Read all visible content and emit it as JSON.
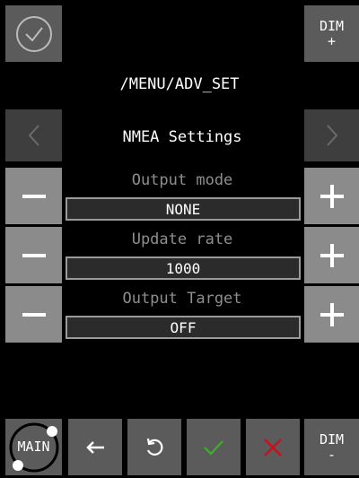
{
  "header": {
    "path": "/MENU/ADV_SET",
    "dim_plus": {
      "line1": "DIM",
      "line2": "+"
    }
  },
  "nav": {
    "title": "NMEA Settings"
  },
  "settings": [
    {
      "label": "Output mode",
      "value": "NONE"
    },
    {
      "label": "Update rate",
      "value": "1000"
    },
    {
      "label": "Output Target",
      "value": "OFF"
    }
  ],
  "footer": {
    "main_label": "MAIN",
    "dim_minus": {
      "line1": "DIM",
      "line2": "-"
    }
  },
  "colors": {
    "accept_green": "#3fae2c",
    "cancel_red": "#c8101e",
    "tile_gray": "#5b5b5b"
  }
}
